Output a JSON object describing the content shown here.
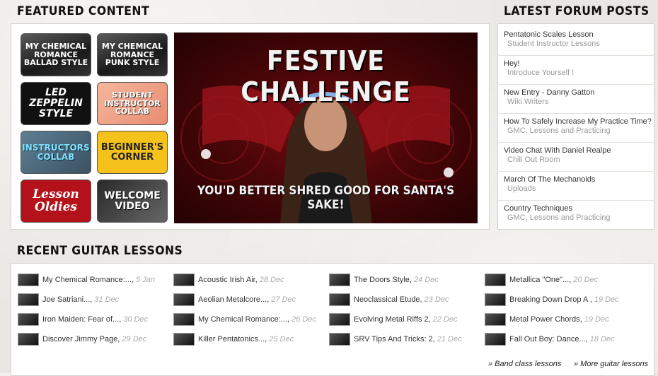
{
  "featured": {
    "heading": "FEATURED CONTENT",
    "thumbs": [
      {
        "label": "MY CHEMICAL ROMANCE BALLAD STYLE"
      },
      {
        "label": "MY CHEMICAL ROMANCE PUNK STYLE"
      },
      {
        "label": "LED ZEPPELIN STYLE"
      },
      {
        "label": "STUDENT INSTRUCTOR COLLAB"
      },
      {
        "label": "INSTRUCTORS COLLAB"
      },
      {
        "label": "BEGINNER'S CORNER"
      },
      {
        "label": "Lesson Oldies"
      },
      {
        "label": "WELCOME VIDEO"
      }
    ],
    "banner": {
      "title": "FESTIVE CHALLENGE",
      "subtitle": "YOU'D BETTER SHRED GOOD FOR SANTA'S SAKE!"
    }
  },
  "forum": {
    "heading": "LATEST FORUM POSTS",
    "posts": [
      {
        "title": "Pentatonic Scales Lesson",
        "category": "Student Instructor Lessons"
      },
      {
        "title": "Hey!",
        "category": "Introduce Yourself !"
      },
      {
        "title": "New Entry - Danny Gatton",
        "category": "Wiki Writers"
      },
      {
        "title": "How To Safely Increase My Practice Time?",
        "category": "GMC, Lessons and Practicing"
      },
      {
        "title": "Video Chat With Daniel Realpe",
        "category": "Chill Out Room"
      },
      {
        "title": "March Of The Mechanoids",
        "category": "Uploads"
      },
      {
        "title": "Country Techniques",
        "category": "GMC, Lessons and Practicing"
      }
    ]
  },
  "lessons": {
    "heading": "RECENT GUITAR LESSONS",
    "columns": [
      [
        {
          "name": "My Chemical Romance:...,",
          "date": "5 Jan"
        },
        {
          "name": "Joe Satriani...,",
          "date": "31 Dec"
        },
        {
          "name": "Iron Maiden: Fear of...,",
          "date": "30 Dec"
        },
        {
          "name": "Discover Jimmy Page,",
          "date": "29 Dec"
        }
      ],
      [
        {
          "name": "Acoustic Irish Air,",
          "date": "28 Dec"
        },
        {
          "name": "Aeolian Metalcore...,",
          "date": "27 Dec"
        },
        {
          "name": "My Chemical Romance:...,",
          "date": "26 Dec"
        },
        {
          "name": "Killer Pentatonics...,",
          "date": "25 Dec"
        }
      ],
      [
        {
          "name": "The Doors Style,",
          "date": "24 Dec"
        },
        {
          "name": "Neoclassical Etude,",
          "date": "23 Dec"
        },
        {
          "name": "Evolving Metal Riffs 2,",
          "date": "22 Dec"
        },
        {
          "name": "SRV Tips And Tricks: 2,",
          "date": "21 Dec"
        }
      ],
      [
        {
          "name": "Metallica \"One\"...,",
          "date": "20 Dec"
        },
        {
          "name": "Breaking Down Drop A ,",
          "date": "19 Dec"
        },
        {
          "name": "Metal Power Chords,",
          "date": "19 Dec"
        },
        {
          "name": "Fall Out Boy: Dance...,",
          "date": "18 Dec"
        }
      ]
    ],
    "band_link": "» Band class lessons",
    "more_link": "» More guitar lessons"
  }
}
